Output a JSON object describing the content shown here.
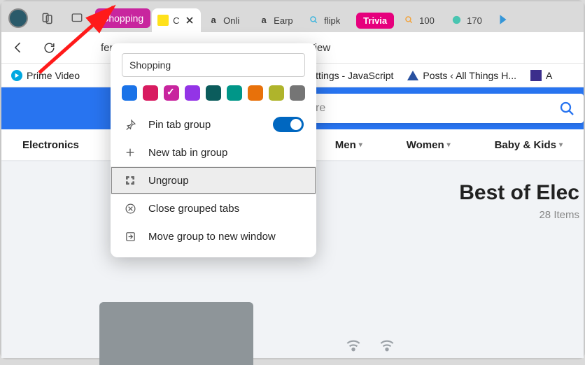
{
  "tab_group": {
    "label": "Shopping",
    "color": "#c8259e"
  },
  "tabs": [
    {
      "favicon_bg": "#ffe11b",
      "title": "C",
      "active": true
    },
    {
      "favicon_kind": "amazon",
      "title": "Onli"
    },
    {
      "favicon_kind": "amazon",
      "title": "Earp"
    },
    {
      "favicon_kind": "bing",
      "title": "flipk"
    }
  ],
  "tabs_after": [
    {
      "pill": "Trivia",
      "pill_color": "#e6007d"
    },
    {
      "favicon_kind": "bing",
      "title": "100"
    },
    {
      "favicon_kind": "edge",
      "title": "170"
    }
  ],
  "url_fragment": "fers-list/content?screen=dynamic&pk=themeView",
  "bookmarks": [
    {
      "icon": "prime",
      "label": "Prime Video"
    },
    {
      "icon": "none",
      "label": "Settings - JavaScript"
    },
    {
      "icon": "tri",
      "label": "Posts ‹ All Things H..."
    },
    {
      "icon": "eq",
      "label": "A"
    }
  ],
  "search_placeholder": "products, brands and more",
  "categories": [
    "Electronics",
    "Men",
    "Women",
    "Baby & Kids"
  ],
  "hero": {
    "title": "Best of Elec",
    "subtitle": "28 Items"
  },
  "popup": {
    "name_value": "Shopping",
    "colors": [
      {
        "hex": "#1a73e8",
        "sel": false
      },
      {
        "hex": "#d81b60",
        "sel": false
      },
      {
        "hex": "#c8259e",
        "sel": true
      },
      {
        "hex": "#9334e6",
        "sel": false
      },
      {
        "hex": "#0b5c5c",
        "sel": false
      },
      {
        "hex": "#009688",
        "sel": false
      },
      {
        "hex": "#e8710a",
        "sel": false
      },
      {
        "hex": "#afb42b",
        "sel": false
      },
      {
        "hex": "#757575",
        "sel": false
      }
    ],
    "items": {
      "pin": "Pin tab group",
      "newtab": "New tab in group",
      "ungroup": "Ungroup",
      "close": "Close grouped tabs",
      "move": "Move group to new window"
    },
    "pin_on": true
  }
}
